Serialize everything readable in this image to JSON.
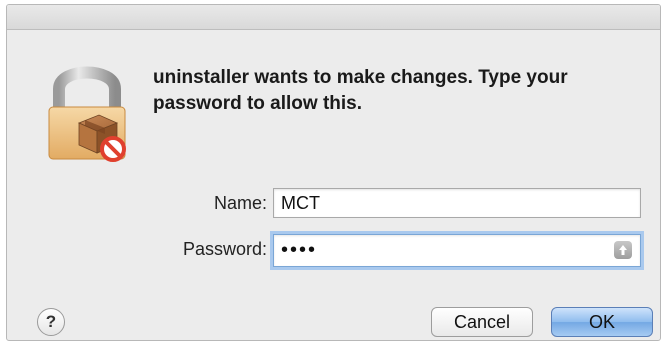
{
  "dialog": {
    "message": "uninstaller wants to make changes. Type your password to allow this.",
    "icon": "lock-package-icon"
  },
  "form": {
    "name_label": "Name:",
    "name_value": "MCT",
    "password_label": "Password:",
    "password_value": "••••",
    "keychain_icon": "keychain-arrow-icon"
  },
  "buttons": {
    "help_label": "?",
    "cancel_label": "Cancel",
    "ok_label": "OK"
  },
  "colors": {
    "dialog_bg": "#ececec",
    "focus_ring": "#a9c9ee",
    "default_button": "#74a8e4",
    "error_badge": "#e0402e"
  }
}
